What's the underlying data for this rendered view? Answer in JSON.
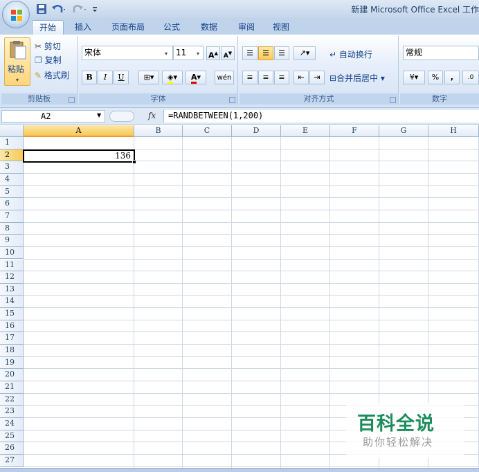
{
  "window": {
    "title": "新建 Microsoft Office Excel 工作"
  },
  "tabs": [
    "开始",
    "插入",
    "页面布局",
    "公式",
    "数据",
    "审阅",
    "视图"
  ],
  "ribbon": {
    "clipboard": {
      "paste": "粘贴",
      "cut": "剪切",
      "copy": "复制",
      "format_painter": "格式刷",
      "label": "剪贴板"
    },
    "font": {
      "name": "宋体",
      "size": "11",
      "label": "字体",
      "bold": "B",
      "italic": "I",
      "underline": "U"
    },
    "alignment": {
      "wrap": "自动换行",
      "merge": "合并后居中",
      "label": "对齐方式"
    },
    "number": {
      "format": "常规",
      "label": "数字",
      "percent": "%",
      "comma": ","
    }
  },
  "formula_bar": {
    "name_box": "A2",
    "fx": "fx",
    "formula": "=RANDBETWEEN(1,200)"
  },
  "grid": {
    "columns": [
      "A",
      "B",
      "C",
      "D",
      "E",
      "F",
      "G",
      "H"
    ],
    "rows": [
      "1",
      "2",
      "3",
      "4",
      "5",
      "6",
      "7",
      "8",
      "9",
      "10",
      "11",
      "12",
      "13",
      "14",
      "15",
      "16",
      "17",
      "18",
      "19",
      "20",
      "21",
      "22",
      "23",
      "24",
      "25",
      "26",
      "27"
    ],
    "active_cell_value": "136"
  },
  "watermark": {
    "title": "百科全说",
    "subtitle": "助你轻松解决"
  },
  "colors": {
    "accent": "#15428b",
    "active_header": "#f8c956",
    "watermark_green": "#1c8d5a"
  }
}
